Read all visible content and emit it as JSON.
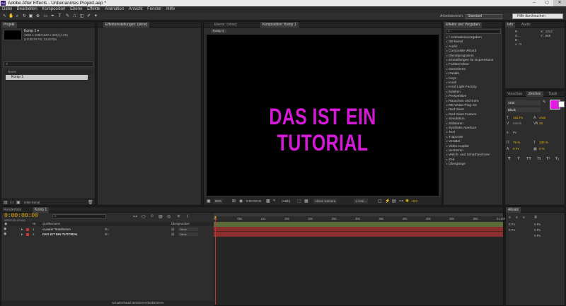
{
  "window": {
    "app_icon": "Ae",
    "title": "Adobe After Effects - Unbenanntes Projekt.aep *",
    "min": "–",
    "max": "▢",
    "close": "✕"
  },
  "menu": [
    "Datei",
    "Bearbeiten",
    "Komposition",
    "Ebene",
    "Effekte",
    "Animation",
    "Ansicht",
    "Fenster",
    "Hilfe"
  ],
  "toolbar": {
    "workspace_label": "Arbeitsbereich:",
    "workspace_value": "Standard",
    "help_placeholder": "Hilfe durchsuchen"
  },
  "project_panel": {
    "tab": "Projekt",
    "comp_name": "Komp 1 ▾",
    "comp_info1": "1920 x 1080 (640 x 360) (1,00)",
    "comp_info2": "Δ 0:00:01:02, 24,00 fps",
    "col_name": "Name",
    "item": "Komp 1",
    "bpc": "8-Bit-Kanal"
  },
  "effects_settings_panel": {
    "tab": "Effekteinstellungen: (ohne)"
  },
  "comp_panel": {
    "tab_footage": "Ebene: (ohne)",
    "tab_comp": "Komposition: Komp 1",
    "breadcrumb": "Komp 1",
    "canvas_text": "DAS IST EIN TUTORIAL",
    "canvas_text_color": "#d41ad6",
    "zoom": "50%",
    "timecode": "0:00:00:00",
    "resolution": "(Halb)",
    "camera": "Aktive Kamera",
    "views": "1 Ansi...",
    "exposure": "+0,0"
  },
  "effects_panel": {
    "tab": "Effekte und Vorgaben",
    "items": [
      "* Animationsvorgaben",
      "3D-Kanal",
      "Audio",
      "Composite Wizard",
      "Dienstprogramm",
      "Einstellungen für Expressions",
      "Farbkorrektur",
      "Generieren",
      "Kanäle",
      "Keys",
      "Knoll",
      "Knoll Light Factory",
      "Masken",
      "Perspektive",
      "Rauschen und Korn",
      "RE:Vision Plug-ins",
      "Red Giant",
      "Red Giant Feature",
      "Simulation",
      "Stilisieren",
      "Synthetic Aperture",
      "Text",
      "Trapcode",
      "Veraltet",
      "Video Copilot",
      "Verzerren",
      "Weich- und Scharfzeichnen",
      "Zeit",
      "Übergänge"
    ]
  },
  "info_panel": {
    "tab_info": "Info",
    "tab_audio": "Audio",
    "r": "R :",
    "g": "G :",
    "b": "B :",
    "a": "A : 0",
    "x": "X : 1314",
    "y": "Y : 868"
  },
  "character_panel": {
    "tab_para": "Vorschau",
    "tab_char": "Zeichen",
    "tab_tracker": "Track",
    "font": "Arial",
    "style": "Black",
    "size": "183 Px",
    "leading": "Auto",
    "kerning": "Metrik",
    "tracking": "25",
    "stroke": "Px",
    "vscale": "75 %",
    "hscale": "100 %",
    "baseline": "0 Px",
    "tsume": "0 %",
    "fill_color": "#e21ce0",
    "styles": [
      "T",
      "T",
      "TT",
      "Tt",
      "T¹",
      "T₁"
    ]
  },
  "timeline_panel": {
    "tab_render": "Renderliste",
    "tab_comp": "Komp 1",
    "timecode": "0:00:00:00",
    "frames": "00000 (24.00 fps)",
    "col_num": "Nr.",
    "col_source": "Quellenname",
    "col_parent": "Übergeordnet",
    "layers": [
      {
        "num": "1",
        "name": "<Leerer Textebene>",
        "parent": "Ohne"
      },
      {
        "num": "2",
        "name": "DAS IST EIN TUTORIAL",
        "parent": "Ohne"
      }
    ],
    "ruler": [
      "0s",
      "05s",
      "10s",
      "15s",
      "20s",
      "25s",
      "30s",
      "35s",
      "40s",
      "45s",
      "50s",
      "55s",
      "01:00s"
    ],
    "toggle_label": "Schalter/Modi aktivieren/deaktivieren"
  },
  "align_panel": {
    "tab": "Absatz",
    "v1": "0 Px",
    "v2": "0 Px",
    "v3": "0 Px",
    "v4": "0 Px",
    "v5": "0 Px"
  }
}
